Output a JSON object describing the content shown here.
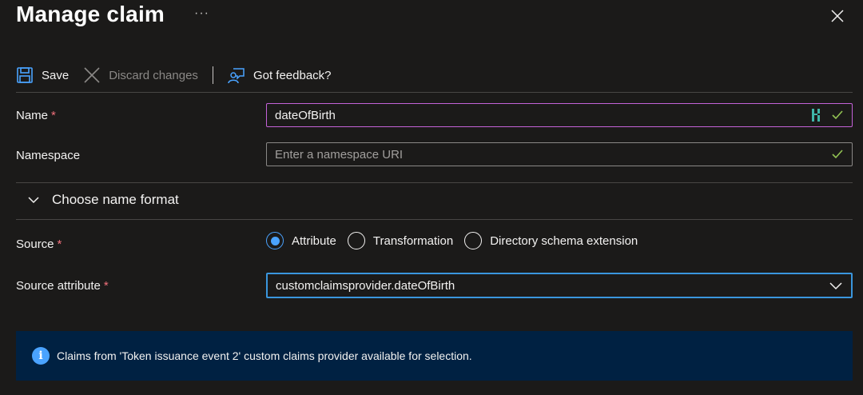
{
  "header": {
    "title": "Manage claim",
    "more_label": "···"
  },
  "toolbar": {
    "save_label": "Save",
    "discard_label": "Discard changes",
    "feedback_label": "Got feedback?"
  },
  "form": {
    "name": {
      "label": "Name",
      "required_mark": "*",
      "value": "dateOfBirth"
    },
    "namespace": {
      "label": "Namespace",
      "placeholder": "Enter a namespace URI"
    },
    "name_format": {
      "label": "Choose name format"
    },
    "source": {
      "label": "Source",
      "required_mark": "*",
      "options": [
        "Attribute",
        "Transformation",
        "Directory schema extension"
      ],
      "selected": "Attribute"
    },
    "source_attribute": {
      "label": "Source attribute",
      "required_mark": "*",
      "value": "customclaimsprovider.dateOfBirth"
    }
  },
  "info_banner": {
    "text": "Claims from 'Token issuance event 2' custom claims provider available for selection."
  },
  "colors": {
    "background": "#1b1a19",
    "accent_blue": "#4aa3ff",
    "focus_purple": "#c462d8",
    "required_red": "#f1707b",
    "valid_green": "#92c353",
    "banner_bg": "#002142"
  },
  "icons": [
    "close-icon",
    "save-icon",
    "discard-icon",
    "feedback-icon",
    "password-manager-icon",
    "check-icon",
    "chevron-down-icon",
    "info-icon"
  ]
}
